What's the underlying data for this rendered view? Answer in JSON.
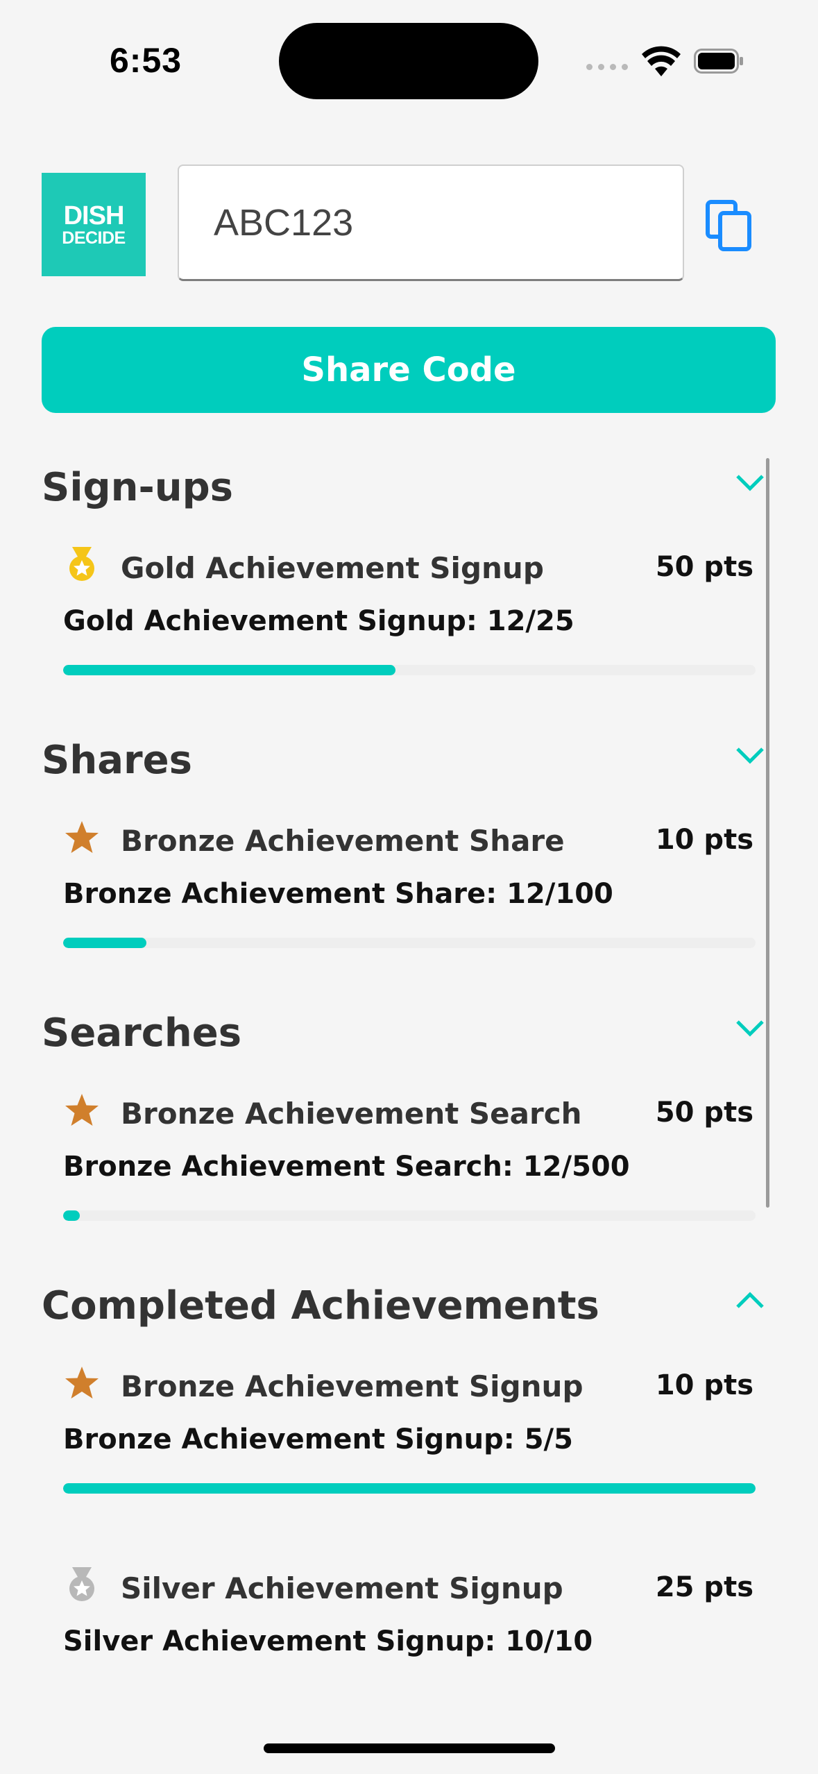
{
  "status_bar": {
    "time": "6:53"
  },
  "header": {
    "logo_line1": "DISH",
    "logo_line2": "DECIDE",
    "code_value": "ABC123",
    "share_label": "Share Code"
  },
  "colors": {
    "accent": "#00cdbd",
    "gold": "#f5c518",
    "bronze": "#d07f2c",
    "silver": "#b8b8b8"
  },
  "sections": [
    {
      "title": "Sign-ups",
      "chevron": "chevron-down-icon"
    },
    {
      "title": "Shares",
      "chevron": "chevron-down-icon"
    },
    {
      "title": "Searches",
      "chevron": "chevron-down-icon"
    },
    {
      "title": "Completed Achievements",
      "chevron": "chevron-up-icon"
    }
  ],
  "achievements": [
    {
      "icon": "gold-medal-icon",
      "name": "Gold Achievement Signup",
      "points": "50 pts",
      "progress_text": "Gold Achievement Signup: 12/25",
      "progress": 0.48
    },
    {
      "icon": "bronze-star-icon",
      "name": "Bronze Achievement Share",
      "points": "10 pts",
      "progress_text": "Bronze Achievement Share: 12/100",
      "progress": 0.12
    },
    {
      "icon": "bronze-star-icon",
      "name": "Bronze Achievement Search",
      "points": "50 pts",
      "progress_text": "Bronze Achievement Search: 12/500",
      "progress": 0.024
    },
    {
      "icon": "bronze-star-icon",
      "name": "Bronze Achievement Signup",
      "points": "10 pts",
      "progress_text": "Bronze Achievement Signup: 5/5",
      "progress": 1.0
    },
    {
      "icon": "silver-medal-icon",
      "name": "Silver Achievement Signup",
      "points": "25 pts",
      "progress_text": "Silver Achievement Signup: 10/10",
      "progress": 1.0
    }
  ]
}
